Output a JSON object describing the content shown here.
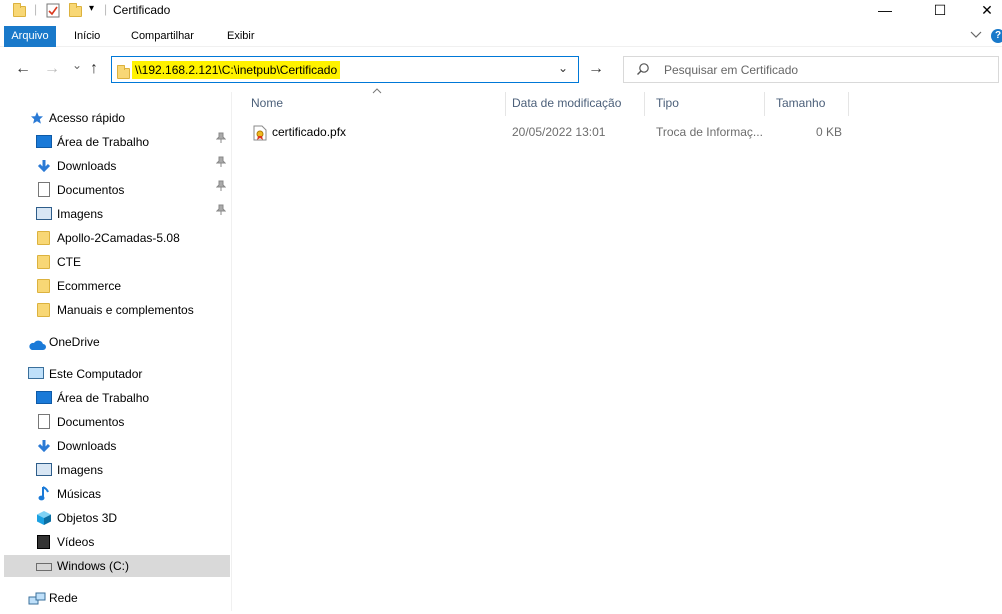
{
  "window": {
    "title": "Certificado",
    "minimize": "—",
    "maximize": "☐",
    "close": "✕"
  },
  "ribbon": {
    "tabs": [
      "Arquivo",
      "Início",
      "Compartilhar",
      "Exibir"
    ],
    "expand_icon": "chevron-down-icon",
    "help": "?"
  },
  "nav": {
    "back": "←",
    "forward": "→",
    "recent": "⌄",
    "up": "↑",
    "address": "\\\\192.168.2.121\\C:\\inetpub\\Certificado",
    "address_dropdown": "⌄",
    "go": "→",
    "search_placeholder": "Pesquisar em Certificado",
    "accent": "#0078d7",
    "highlight": "#fff200"
  },
  "sidebar": {
    "quick_access": {
      "label": "Acesso rápido",
      "items": [
        {
          "label": "Área de Trabalho",
          "icon": "desktop-icon",
          "pinned": true
        },
        {
          "label": "Downloads",
          "icon": "download-icon",
          "pinned": true
        },
        {
          "label": "Documentos",
          "icon": "document-icon",
          "pinned": true
        },
        {
          "label": "Imagens",
          "icon": "image-icon",
          "pinned": true
        },
        {
          "label": "Apollo-2Camadas-5.08",
          "icon": "folder-icon",
          "pinned": false
        },
        {
          "label": "CTE",
          "icon": "folder-icon",
          "pinned": false
        },
        {
          "label": "Ecommerce",
          "icon": "folder-icon",
          "pinned": false
        },
        {
          "label": "Manuais e complementos",
          "icon": "folder-icon",
          "pinned": false
        }
      ]
    },
    "onedrive": {
      "label": "OneDrive"
    },
    "this_pc": {
      "label": "Este Computador",
      "items": [
        {
          "label": "Área de Trabalho",
          "icon": "desktop-icon"
        },
        {
          "label": "Documentos",
          "icon": "document-icon"
        },
        {
          "label": "Downloads",
          "icon": "download-icon"
        },
        {
          "label": "Imagens",
          "icon": "image-icon"
        },
        {
          "label": "Músicas",
          "icon": "music-icon"
        },
        {
          "label": "Objetos 3D",
          "icon": "cube-icon"
        },
        {
          "label": "Vídeos",
          "icon": "video-icon"
        },
        {
          "label": "Windows (C:)",
          "icon": "drive-icon",
          "selected": true
        }
      ]
    },
    "network": {
      "label": "Rede"
    },
    "pin_glyph": "📌"
  },
  "files": {
    "columns": [
      "Nome",
      "Data de modificação",
      "Tipo",
      "Tamanho"
    ],
    "sort_indicator": "^",
    "rows": [
      {
        "name": "certificado.pfx",
        "modified": "20/05/2022 13:01",
        "type": "Troca de Informaç...",
        "size": "0 KB",
        "icon": "certificate-file-icon"
      }
    ]
  }
}
